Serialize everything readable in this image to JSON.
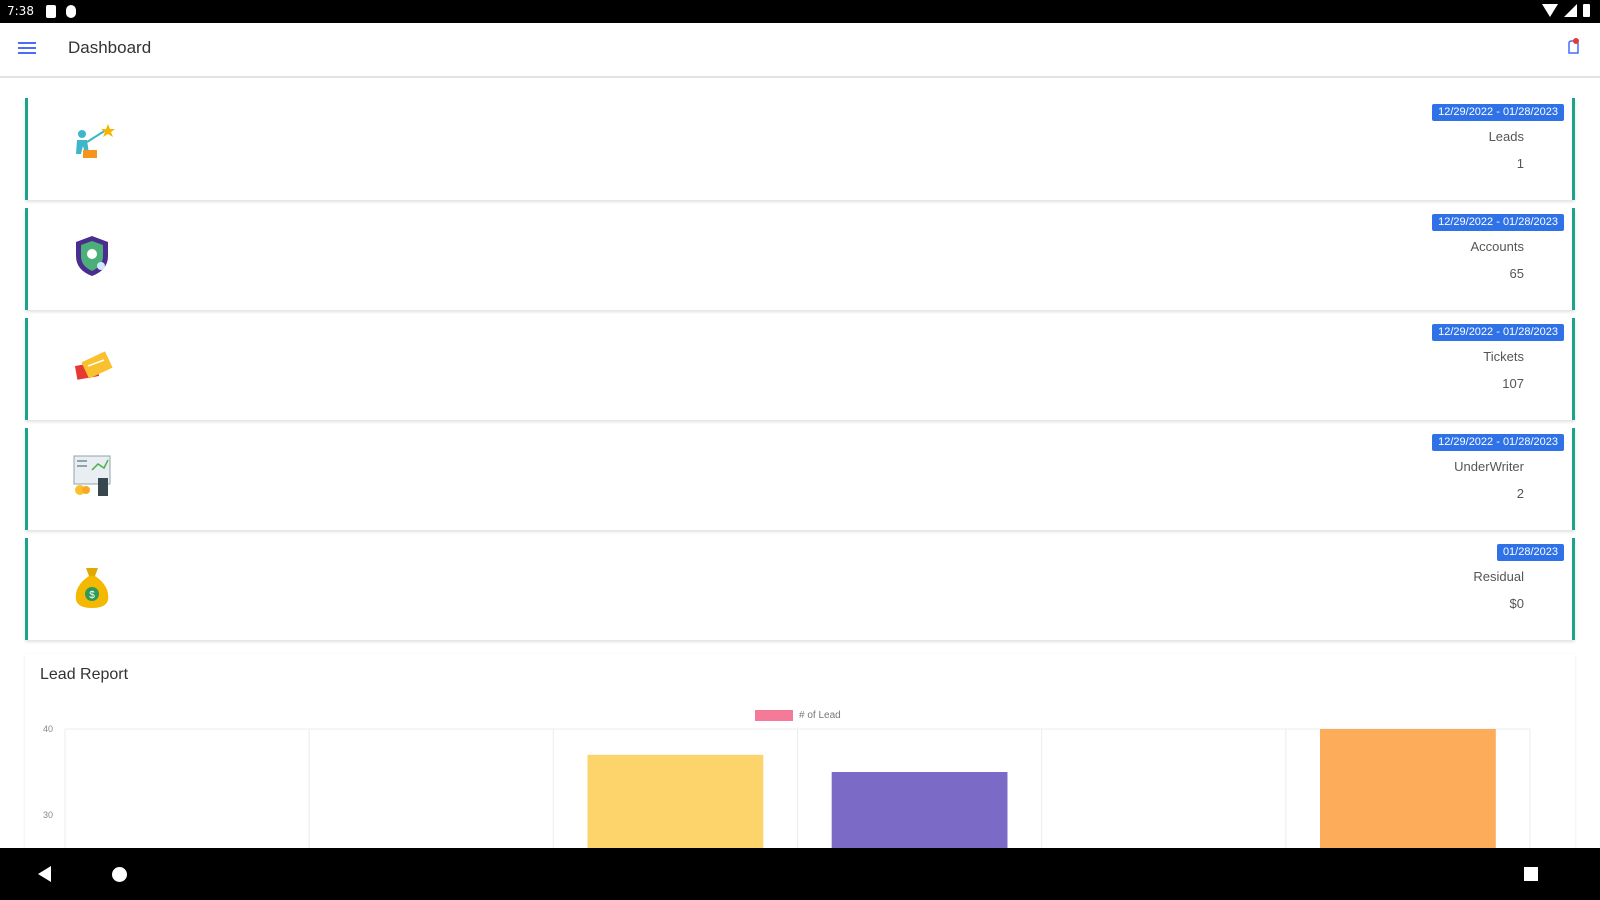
{
  "status_bar": {
    "time": "7:38"
  },
  "app_bar": {
    "title": "Dashboard"
  },
  "cards": [
    {
      "date_range": "12/29/2022 - 01/28/2023",
      "label": "Leads",
      "value": "1",
      "icon": "lead-person-icon"
    },
    {
      "date_range": "12/29/2022 - 01/28/2023",
      "label": "Accounts",
      "value": "65",
      "icon": "shield-account-icon"
    },
    {
      "date_range": "12/29/2022 - 01/28/2023",
      "label": "Tickets",
      "value": "107",
      "icon": "ticket-icon"
    },
    {
      "date_range": "12/29/2022 - 01/28/2023",
      "label": "UnderWriter",
      "value": "2",
      "icon": "underwriter-calculator-icon"
    },
    {
      "date_range": "01/28/2023",
      "label": "Residual",
      "value": "$0",
      "icon": "money-bag-icon"
    }
  ],
  "report": {
    "title": "Lead Report",
    "legend": "# of Lead"
  },
  "chart_data": {
    "type": "bar",
    "series": [
      {
        "name": "# of Lead"
      }
    ],
    "y_ticks": [
      "40",
      "30"
    ],
    "bars": [
      {
        "slot": 2,
        "value": 37,
        "color": "#fdd36b"
      },
      {
        "slot": 3,
        "value": 35,
        "color": "#7b6bc6"
      },
      {
        "slot": 5,
        "value": 40,
        "color": "#fdad5a"
      }
    ],
    "grid": true
  }
}
